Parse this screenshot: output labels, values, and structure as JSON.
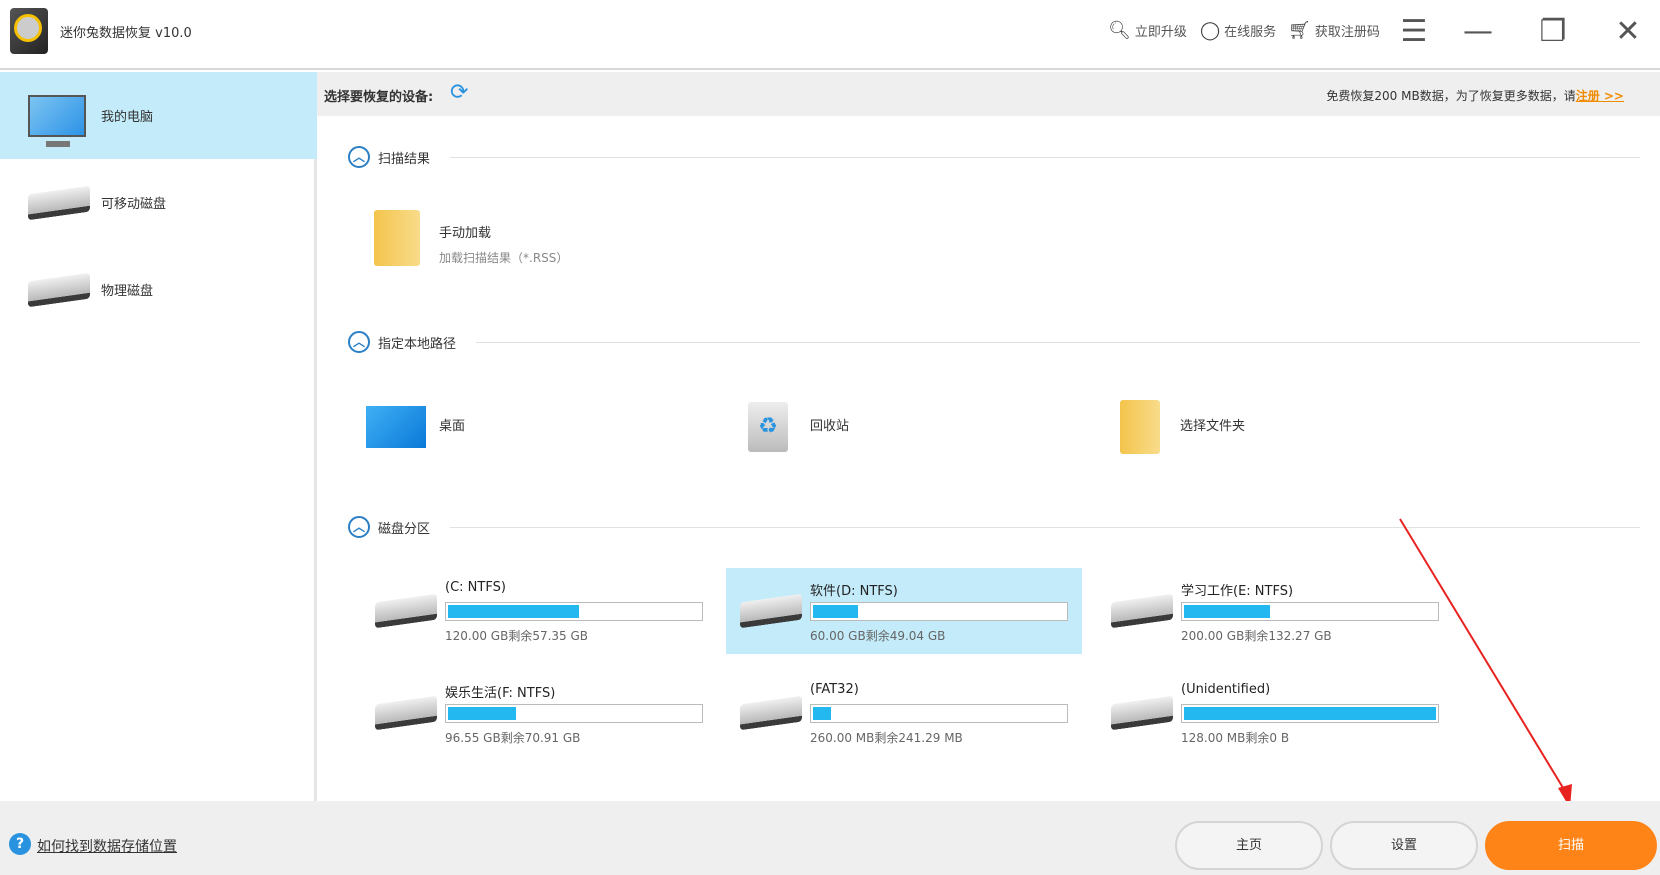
{
  "title": "迷你兔数据恢复 v10.0",
  "toolbar": {
    "upgrade": "立即升级",
    "service": "在线服务",
    "regcode": "获取注册码"
  },
  "sidebar": {
    "items": [
      {
        "label": "我的电脑"
      },
      {
        "label": "可移动磁盘"
      },
      {
        "label": "物理磁盘"
      }
    ]
  },
  "subheader": {
    "label": "选择要恢复的设备:",
    "notice": "免费恢复200 MB数据，为了恢复更多数据，请",
    "register": "注册 >>"
  },
  "sections": {
    "scan_results": {
      "title": "扫描结果",
      "load_title": "手动加载",
      "load_desc": "加载扫描结果（*.RSS）"
    },
    "local_path": {
      "title": "指定本地路径",
      "items": [
        {
          "label": "桌面"
        },
        {
          "label": "回收站"
        },
        {
          "label": "选择文件夹"
        }
      ]
    },
    "partitions": {
      "title": "磁盘分区",
      "drives": [
        {
          "name": "(C: NTFS)",
          "caption": "120.00 GB剩余57.35 GB",
          "used_fraction": 0.52
        },
        {
          "name": "软件(D: NTFS)",
          "caption": "60.00 GB剩余49.04 GB",
          "used_fraction": 0.18
        },
        {
          "name": "学习工作(E: NTFS)",
          "caption": "200.00 GB剩余132.27 GB",
          "used_fraction": 0.34
        },
        {
          "name": "娱乐生活(F: NTFS)",
          "caption": "96.55 GB剩余70.91 GB",
          "used_fraction": 0.27
        },
        {
          "name": "(FAT32)",
          "caption": "260.00 MB剩余241.29 MB",
          "used_fraction": 0.07
        },
        {
          "name": "(Unidentified)",
          "caption": "128.00 MB剩余0 B",
          "used_fraction": 1.0
        }
      ]
    }
  },
  "footer": {
    "help": "如何找到数据存储位置",
    "home": "主页",
    "settings": "设置",
    "scan": "扫描"
  },
  "colors": {
    "accent": "#23b8ef",
    "scan": "#ff8418",
    "selected": "#c3ebfa"
  }
}
